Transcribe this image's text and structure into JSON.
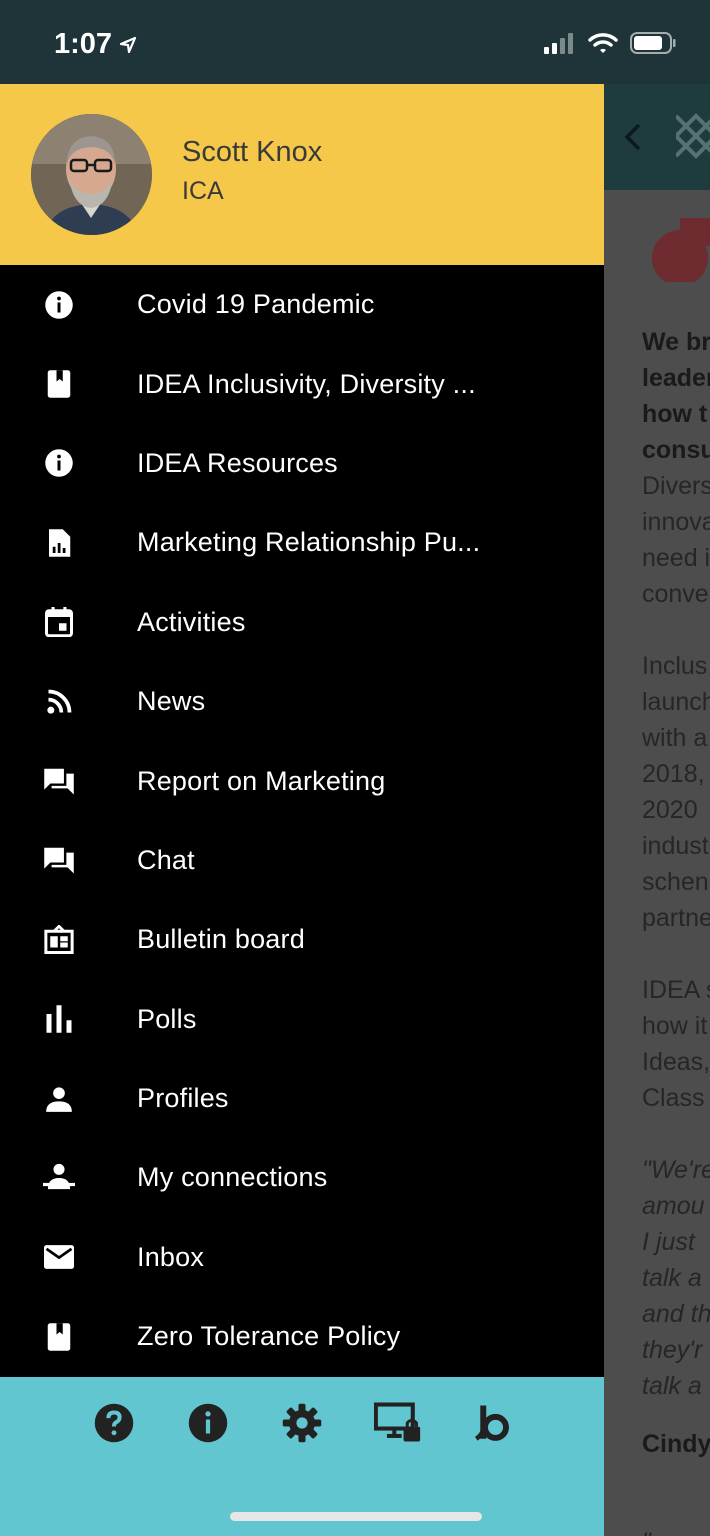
{
  "status_bar": {
    "time": "1:07"
  },
  "profile": {
    "name": "Scott Knox",
    "organization": "ICA"
  },
  "menu": [
    {
      "label": "Covid 19 Pandemic",
      "icon": "info-icon"
    },
    {
      "label": "IDEA Inclusivity, Diversity ...",
      "icon": "book-icon"
    },
    {
      "label": "IDEA Resources",
      "icon": "info-icon"
    },
    {
      "label": "Marketing Relationship Pu...",
      "icon": "report-icon"
    },
    {
      "label": "Activities",
      "icon": "calendar-icon"
    },
    {
      "label": "News",
      "icon": "rss-icon"
    },
    {
      "label": "Report on Marketing",
      "icon": "forum-icon"
    },
    {
      "label": "Chat",
      "icon": "forum-icon"
    },
    {
      "label": "Bulletin board",
      "icon": "bulletin-board-icon"
    },
    {
      "label": "Polls",
      "icon": "bar-chart-icon"
    },
    {
      "label": "Profiles",
      "icon": "person-icon"
    },
    {
      "label": "My connections",
      "icon": "connections-icon"
    },
    {
      "label": "Inbox",
      "icon": "mail-icon"
    },
    {
      "label": "Zero Tolerance Policy",
      "icon": "book-icon"
    }
  ],
  "bottom_bar": [
    "help-icon",
    "info-icon",
    "settings-icon",
    "screen-lock-icon",
    "brand-b-icon"
  ],
  "background_content": {
    "bold_lines": [
      "We br",
      "leader",
      "how t",
      "consu"
    ],
    "para1": [
      "Divers",
      "innova",
      "need i",
      "conve"
    ],
    "para2": [
      "Inclus",
      "launch",
      "with a",
      "2018,",
      " 2020",
      "indust",
      "schen",
      "partne"
    ],
    "para3": [
      "IDEA s",
      "how it",
      "Ideas,",
      "Class"
    ],
    "quote": [
      "\"We're",
      "amou",
      "I just",
      "talk a",
      "and th",
      "they'r",
      "talk a"
    ],
    "signature": "Cindy",
    "last": "\"...we"
  },
  "colors": {
    "header_yellow": "#f5c84a",
    "drawer_bg": "#000000",
    "bottom_bar": "#62c6d0",
    "status_bar": "#1f3438"
  }
}
